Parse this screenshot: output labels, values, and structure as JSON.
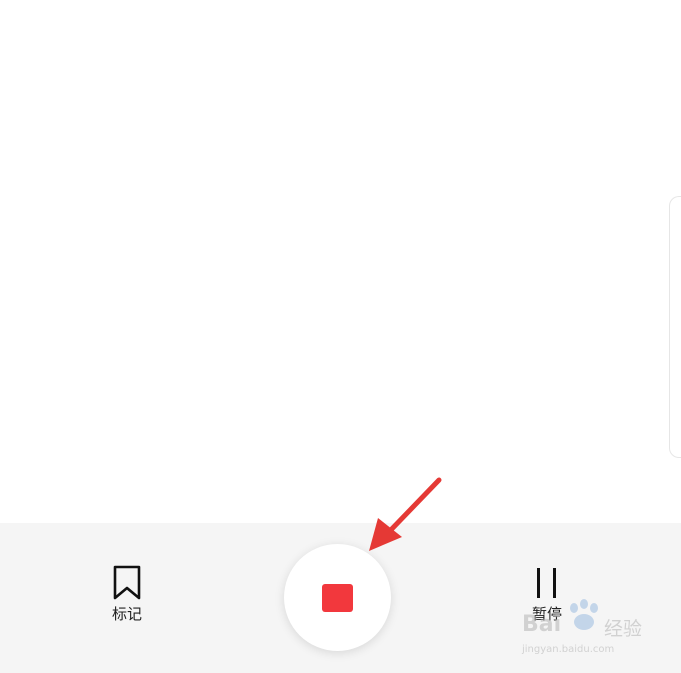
{
  "toolbar": {
    "mark_label": "标记",
    "pause_label": "暂停"
  },
  "icons": {
    "mark": "bookmark-icon",
    "pause": "pause-icon",
    "record": "stop-icon"
  },
  "colors": {
    "accent": "#f2383d",
    "annotation_arrow": "#e53935",
    "bottom_bar_bg": "#f5f5f5"
  },
  "watermark": {
    "brand": "Bai",
    "brand_cn": "经验",
    "url": "jingyan.baidu.com"
  }
}
